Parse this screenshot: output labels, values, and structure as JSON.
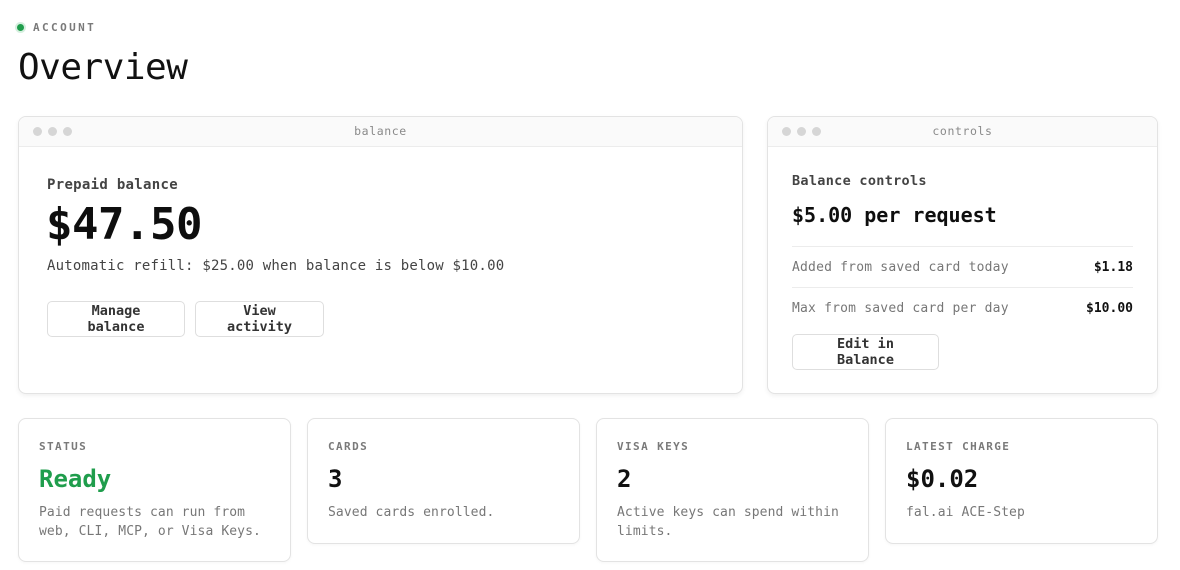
{
  "header": {
    "eyebrow": "ACCOUNT",
    "title": "Overview"
  },
  "colors": {
    "accent_green": "#1f9d4c",
    "text_primary": "#111111",
    "text_muted": "#777777",
    "border": "#e3e3e3"
  },
  "balance_window": {
    "title": "balance",
    "label": "Prepaid balance",
    "amount": "$47.50",
    "refill_text": "Automatic refill: $25.00 when balance is below $10.00",
    "manage_button": "Manage balance",
    "activity_button": "View activity"
  },
  "controls_window": {
    "title": "controls",
    "label": "Balance controls",
    "amount": "$5.00 per request",
    "rows": [
      {
        "label": "Added from saved card today",
        "value": "$1.18"
      },
      {
        "label": "Max from saved card per day",
        "value": "$10.00"
      }
    ],
    "edit_button": "Edit in Balance"
  },
  "stats": [
    {
      "label": "STATUS",
      "value": "Ready",
      "description": "Paid requests can run from web, CLI, MCP, or Visa Keys."
    },
    {
      "label": "CARDS",
      "value": "3",
      "description": "Saved cards enrolled."
    },
    {
      "label": "VISA KEYS",
      "value": "2",
      "description": "Active keys can spend within limits."
    },
    {
      "label": "LATEST CHARGE",
      "value": "$0.02",
      "description": "fal.ai ACE-Step"
    }
  ]
}
